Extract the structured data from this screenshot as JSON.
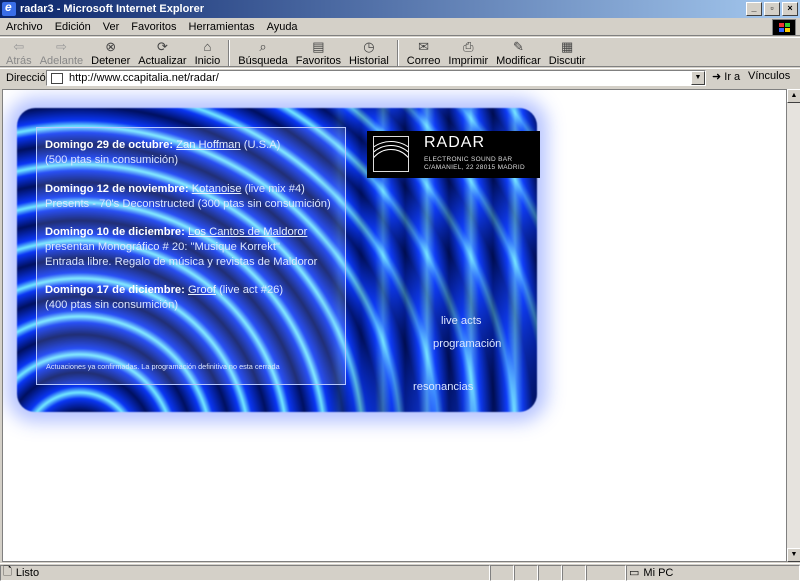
{
  "window": {
    "title": "radar3 - Microsoft Internet Explorer",
    "buttons": [
      "_",
      "▫",
      "×"
    ]
  },
  "menubar": {
    "items": [
      "Archivo",
      "Edición",
      "Ver",
      "Favoritos",
      "Herramientas",
      "Ayuda"
    ]
  },
  "toolbar": {
    "back": "Atrás",
    "forward": "Adelante",
    "stop": "Detener",
    "refresh": "Actualizar",
    "home": "Inicio",
    "search": "Búsqueda",
    "favorites": "Favoritos",
    "history": "Historial",
    "mail": "Correo",
    "print": "Imprimir",
    "edit": "Modificar",
    "discuss": "Discutir"
  },
  "address": {
    "label": "Dirección",
    "url": "http://www.ccapitalia.net/radar/",
    "go": "Ir a",
    "links": "Vínculos"
  },
  "page": {
    "logo": {
      "title": "RADAR",
      "subtitle": "ELECTRONIC SOUND BAR",
      "address": "C/AMANIEL, 22   28015 MADRID"
    },
    "events": [
      {
        "date": "Domingo 29 de octubre:",
        "artist": "Zan Hoffman",
        "rest": " (U.S.A)",
        "line2": "(500 ptas sin consumición)",
        "line3": ""
      },
      {
        "date": "Domingo 12 de noviembre:",
        "artist": "Kotanoise",
        "rest": " (live mix #4)",
        "line2": "Presents - 70's Deconstructed (300 ptas sin consumición)",
        "line3": ""
      },
      {
        "date": "Domingo 10 de diciembre:",
        "artist": "Los Cantos de Maldoror",
        "rest": "",
        "line2": "presentan Monográfico # 20: \"Musique Korrekt\"",
        "line3": "Entrada libre. Regalo de música y revistas de Maldoror"
      },
      {
        "date": "Domingo 17 de diciembre:",
        "artist": "Groof",
        "rest": "  (live act #26)",
        "line2": "(400 ptas sin consumición)",
        "line3": ""
      }
    ],
    "footnote": "Actuaciones ya confirmadas. La programación definitiva no esta cerrada",
    "nav": {
      "live_acts": "live acts",
      "programacion": "programación",
      "resonancias": "resonancias"
    }
  },
  "status": {
    "text": "Listo",
    "zone": "Mi PC"
  }
}
